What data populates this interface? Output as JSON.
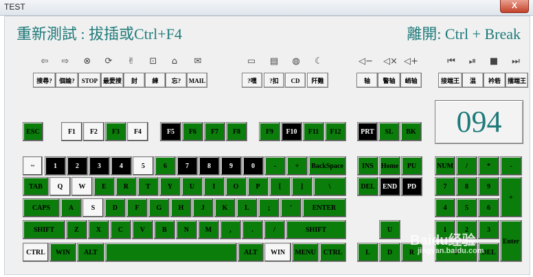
{
  "window": {
    "title": "TEST",
    "close": "X"
  },
  "header": {
    "left": "重新測試 : 拔插或Ctrl+F4",
    "right": "離開: Ctrl + Break"
  },
  "counter": "094",
  "media_icons": [
    "⇦",
    "⇨",
    "⊗",
    "⟳",
    "✌",
    "⊡",
    "⌂",
    "✉",
    "▭",
    "▤",
    "◍",
    "☾",
    "◁−",
    "◁×",
    "◁+",
    "⏮",
    "⏯",
    "■",
    "⏭"
  ],
  "function_buttons": [
    "搜尋?",
    "個論?",
    "STOP",
    "最愛搜",
    "封",
    "練",
    "忘?",
    "MAIL",
    "?嘿",
    "?扣",
    "CD",
    "阡難",
    "轴",
    "警轴",
    "峭轴",
    "接端王",
    "温",
    "衿砦",
    "擂端王"
  ],
  "keys": {
    "esc": "ESC",
    "f1": "F1",
    "f2": "F2",
    "f3": "F3",
    "f4": "F4",
    "f5": "F5",
    "f6": "F6",
    "f7": "F7",
    "f8": "F8",
    "f9": "F9",
    "f10": "F10",
    "f11": "F11",
    "f12": "F12",
    "prt": "PRT",
    "sl": "SL",
    "bk": "BK",
    "tilde": "~",
    "n1": "1",
    "n2": "2",
    "n3": "3",
    "n4": "4",
    "n5": "5",
    "n6": "6",
    "n7": "7",
    "n8": "8",
    "n9": "9",
    "n0": "0",
    "minus": "-",
    "plus": "+",
    "backspace": "BackSpace",
    "tab": "TAB",
    "q": "Q",
    "w": "W",
    "e": "E",
    "r": "R",
    "t": "T",
    "y": "Y",
    "u": "U",
    "i": "I",
    "o": "O",
    "p": "P",
    "lbr": "[",
    "rbr": "]",
    "bslash": "\\",
    "caps": "CAPS",
    "a": "A",
    "s": "S",
    "d": "D",
    "f": "F",
    "g": "G",
    "h": "H",
    "j": "J",
    "k": "K",
    "l": "L",
    "semi": ";",
    "quote": "'",
    "enter": "ENTER",
    "lshift": "SHIFT",
    "z": "Z",
    "x": "X",
    "c": "C",
    "v": "V",
    "b": "B",
    "n": "N",
    "m": "M",
    "comma": ",",
    "dot": ".",
    "slash": "/",
    "rshift": "SHIFT",
    "lctrl": "CTRL",
    "lwin": "WIN",
    "lalt": "ALT",
    "space": "",
    "ralt": "ALT",
    "rwin": "WIN",
    "menu": "MENU",
    "rctrl": "CTRL",
    "ins": "INS",
    "home": "Home",
    "pu": "PU",
    "del": "DEL",
    "end": "END",
    "pd": "PD",
    "up": "U",
    "left": "L",
    "down": "D",
    "right": "R",
    "num": "NUM",
    "kslash": "/",
    "kstar": "*",
    "kminus": "-",
    "k7": "7",
    "k8": "8",
    "k9": "9",
    "kplus": "+",
    "k4": "4",
    "k5": "5",
    "k6": "6",
    "k1": "1",
    "k2": "2",
    "k3": "3",
    "kenter": "Enter",
    "k0": "0",
    "kdel": "DEL"
  },
  "watermark": {
    "brand": "Baidu经验",
    "url": "jingyan.baidu.com"
  }
}
